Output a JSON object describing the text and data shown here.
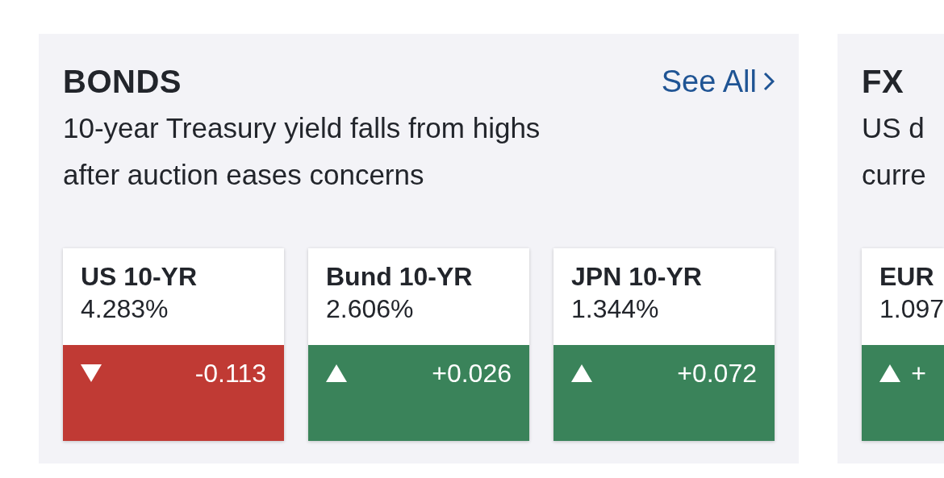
{
  "sections": [
    {
      "title": "BONDS",
      "link": "See All",
      "headline_lines": [
        "10-year Treasury yield falls from highs",
        "after auction eases concerns"
      ],
      "quotes": [
        {
          "name": "US 10-YR",
          "price": "4.283%",
          "rising": false,
          "change": "-0.113"
        },
        {
          "name": "Bund 10-YR",
          "price": "2.606%",
          "rising": true,
          "change": "+0.026"
        },
        {
          "name": "JPN 10-YR",
          "price": "1.344%",
          "rising": true,
          "change": "+0.072"
        }
      ]
    },
    {
      "title": "FX",
      "headline_lines": [
        "US d",
        "curre"
      ],
      "quotes": [
        {
          "name": "EUR",
          "price": "1.097",
          "rising": true,
          "change": "+"
        }
      ]
    }
  ]
}
